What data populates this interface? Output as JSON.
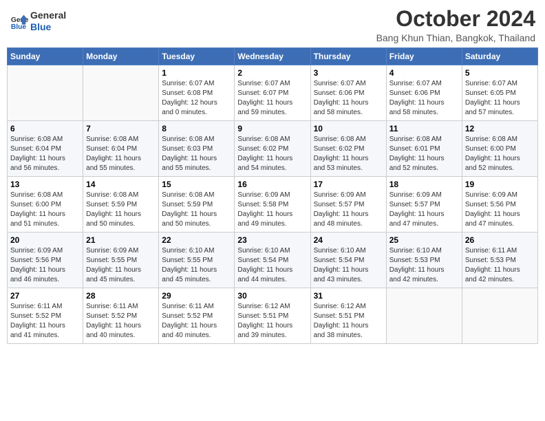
{
  "header": {
    "logo_line1": "General",
    "logo_line2": "Blue",
    "month": "October 2024",
    "location": "Bang Khun Thian, Bangkok, Thailand"
  },
  "days_of_week": [
    "Sunday",
    "Monday",
    "Tuesday",
    "Wednesday",
    "Thursday",
    "Friday",
    "Saturday"
  ],
  "weeks": [
    [
      {
        "day": "",
        "info": ""
      },
      {
        "day": "",
        "info": ""
      },
      {
        "day": "1",
        "info": "Sunrise: 6:07 AM\nSunset: 6:08 PM\nDaylight: 12 hours\nand 0 minutes."
      },
      {
        "day": "2",
        "info": "Sunrise: 6:07 AM\nSunset: 6:07 PM\nDaylight: 11 hours\nand 59 minutes."
      },
      {
        "day": "3",
        "info": "Sunrise: 6:07 AM\nSunset: 6:06 PM\nDaylight: 11 hours\nand 58 minutes."
      },
      {
        "day": "4",
        "info": "Sunrise: 6:07 AM\nSunset: 6:06 PM\nDaylight: 11 hours\nand 58 minutes."
      },
      {
        "day": "5",
        "info": "Sunrise: 6:07 AM\nSunset: 6:05 PM\nDaylight: 11 hours\nand 57 minutes."
      }
    ],
    [
      {
        "day": "6",
        "info": "Sunrise: 6:08 AM\nSunset: 6:04 PM\nDaylight: 11 hours\nand 56 minutes."
      },
      {
        "day": "7",
        "info": "Sunrise: 6:08 AM\nSunset: 6:04 PM\nDaylight: 11 hours\nand 55 minutes."
      },
      {
        "day": "8",
        "info": "Sunrise: 6:08 AM\nSunset: 6:03 PM\nDaylight: 11 hours\nand 55 minutes."
      },
      {
        "day": "9",
        "info": "Sunrise: 6:08 AM\nSunset: 6:02 PM\nDaylight: 11 hours\nand 54 minutes."
      },
      {
        "day": "10",
        "info": "Sunrise: 6:08 AM\nSunset: 6:02 PM\nDaylight: 11 hours\nand 53 minutes."
      },
      {
        "day": "11",
        "info": "Sunrise: 6:08 AM\nSunset: 6:01 PM\nDaylight: 11 hours\nand 52 minutes."
      },
      {
        "day": "12",
        "info": "Sunrise: 6:08 AM\nSunset: 6:00 PM\nDaylight: 11 hours\nand 52 minutes."
      }
    ],
    [
      {
        "day": "13",
        "info": "Sunrise: 6:08 AM\nSunset: 6:00 PM\nDaylight: 11 hours\nand 51 minutes."
      },
      {
        "day": "14",
        "info": "Sunrise: 6:08 AM\nSunset: 5:59 PM\nDaylight: 11 hours\nand 50 minutes."
      },
      {
        "day": "15",
        "info": "Sunrise: 6:08 AM\nSunset: 5:59 PM\nDaylight: 11 hours\nand 50 minutes."
      },
      {
        "day": "16",
        "info": "Sunrise: 6:09 AM\nSunset: 5:58 PM\nDaylight: 11 hours\nand 49 minutes."
      },
      {
        "day": "17",
        "info": "Sunrise: 6:09 AM\nSunset: 5:57 PM\nDaylight: 11 hours\nand 48 minutes."
      },
      {
        "day": "18",
        "info": "Sunrise: 6:09 AM\nSunset: 5:57 PM\nDaylight: 11 hours\nand 47 minutes."
      },
      {
        "day": "19",
        "info": "Sunrise: 6:09 AM\nSunset: 5:56 PM\nDaylight: 11 hours\nand 47 minutes."
      }
    ],
    [
      {
        "day": "20",
        "info": "Sunrise: 6:09 AM\nSunset: 5:56 PM\nDaylight: 11 hours\nand 46 minutes."
      },
      {
        "day": "21",
        "info": "Sunrise: 6:09 AM\nSunset: 5:55 PM\nDaylight: 11 hours\nand 45 minutes."
      },
      {
        "day": "22",
        "info": "Sunrise: 6:10 AM\nSunset: 5:55 PM\nDaylight: 11 hours\nand 45 minutes."
      },
      {
        "day": "23",
        "info": "Sunrise: 6:10 AM\nSunset: 5:54 PM\nDaylight: 11 hours\nand 44 minutes."
      },
      {
        "day": "24",
        "info": "Sunrise: 6:10 AM\nSunset: 5:54 PM\nDaylight: 11 hours\nand 43 minutes."
      },
      {
        "day": "25",
        "info": "Sunrise: 6:10 AM\nSunset: 5:53 PM\nDaylight: 11 hours\nand 42 minutes."
      },
      {
        "day": "26",
        "info": "Sunrise: 6:11 AM\nSunset: 5:53 PM\nDaylight: 11 hours\nand 42 minutes."
      }
    ],
    [
      {
        "day": "27",
        "info": "Sunrise: 6:11 AM\nSunset: 5:52 PM\nDaylight: 11 hours\nand 41 minutes."
      },
      {
        "day": "28",
        "info": "Sunrise: 6:11 AM\nSunset: 5:52 PM\nDaylight: 11 hours\nand 40 minutes."
      },
      {
        "day": "29",
        "info": "Sunrise: 6:11 AM\nSunset: 5:52 PM\nDaylight: 11 hours\nand 40 minutes."
      },
      {
        "day": "30",
        "info": "Sunrise: 6:12 AM\nSunset: 5:51 PM\nDaylight: 11 hours\nand 39 minutes."
      },
      {
        "day": "31",
        "info": "Sunrise: 6:12 AM\nSunset: 5:51 PM\nDaylight: 11 hours\nand 38 minutes."
      },
      {
        "day": "",
        "info": ""
      },
      {
        "day": "",
        "info": ""
      }
    ]
  ]
}
